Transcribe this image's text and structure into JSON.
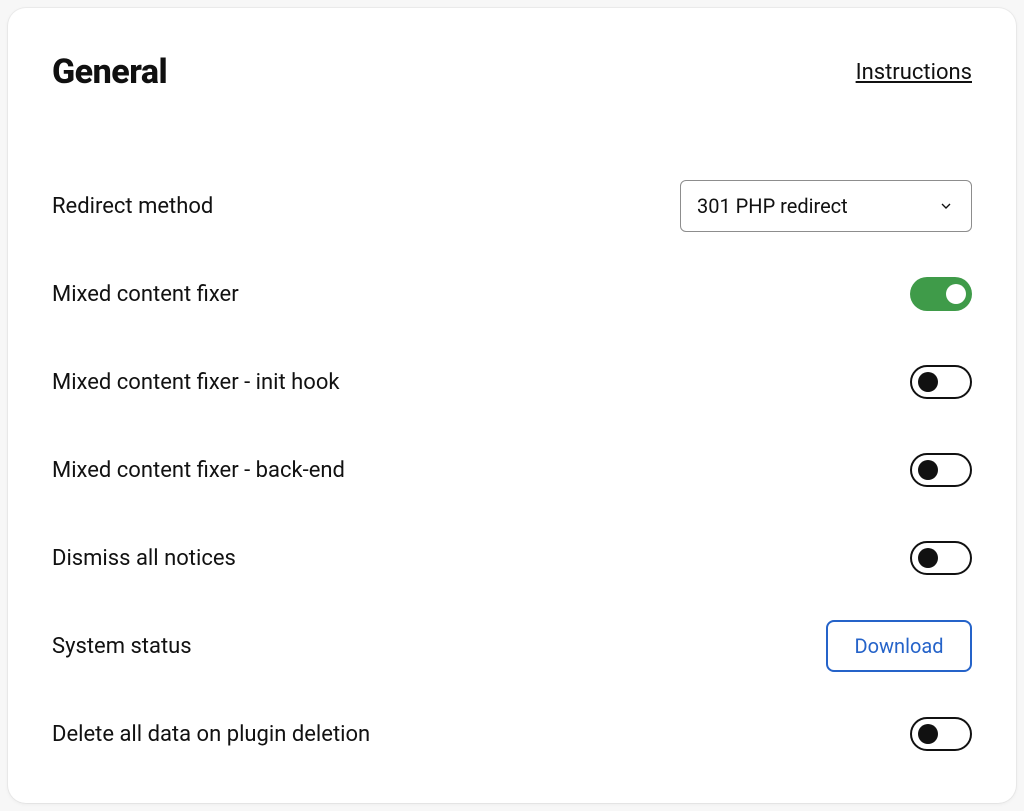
{
  "header": {
    "title": "General",
    "instructions": "Instructions"
  },
  "settings": {
    "redirect_method": {
      "label": "Redirect method",
      "selected": "301 PHP redirect"
    },
    "mixed_content_fixer": {
      "label": "Mixed content fixer",
      "enabled": true
    },
    "mixed_content_fixer_init_hook": {
      "label": "Mixed content fixer - init hook",
      "enabled": false
    },
    "mixed_content_fixer_back_end": {
      "label": "Mixed content fixer - back-end",
      "enabled": false
    },
    "dismiss_all_notices": {
      "label": "Dismiss all notices",
      "enabled": false
    },
    "system_status": {
      "label": "System status",
      "button": "Download"
    },
    "delete_data_on_uninstall": {
      "label": "Delete all data on plugin deletion",
      "enabled": false
    }
  }
}
